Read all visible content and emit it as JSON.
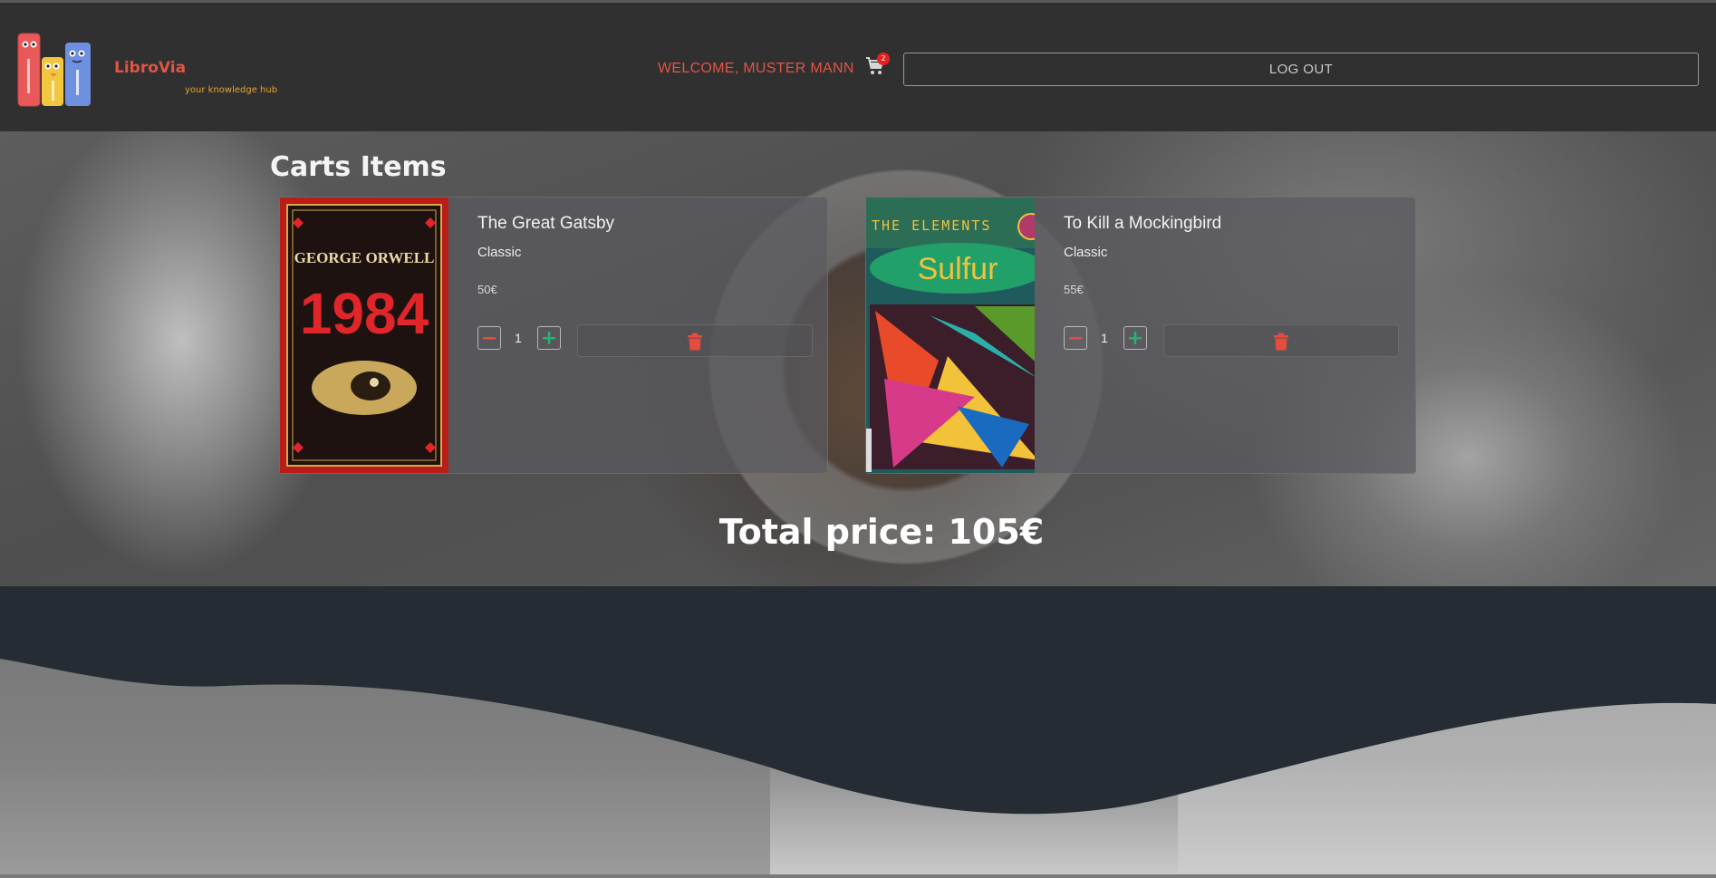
{
  "header": {
    "brand_name": "LibroVia",
    "brand_tagline": "your knowledge hub",
    "welcome_text": "WELCOME, MUSTER MANN",
    "cart_count": "2",
    "logout_label": "LOG OUT",
    "icons": [
      "logo-books-icon",
      "cart-icon"
    ]
  },
  "main": {
    "heading": "Carts Items",
    "items": [
      {
        "title": "The Great Gatsby",
        "genre": "Classic",
        "price": "50€",
        "quantity": "1",
        "cover_text_top": "GEORGE ORWELL",
        "cover_text_main": "1984"
      },
      {
        "title": "To Kill a Mockingbird",
        "genre": "Classic",
        "price": "55€",
        "quantity": "1",
        "cover_text_top": "THE ELEMENTS",
        "cover_text_main": "Sulfur"
      }
    ],
    "total_label": "Total price: 105€"
  },
  "colors": {
    "accent_red": "#e25545",
    "tagline_orange": "#e8a52a",
    "plus_green": "#22b573",
    "delete_red": "#e74c3c",
    "header_bg": "#303030"
  }
}
